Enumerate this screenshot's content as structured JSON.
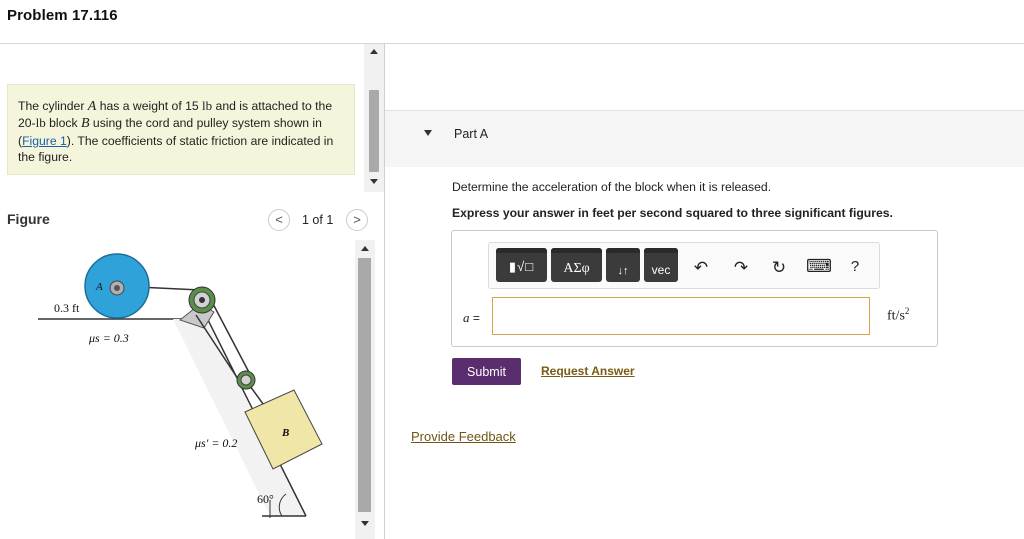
{
  "header": {
    "title": "Problem 17.116"
  },
  "problem": {
    "t1": "The cylinder ",
    "var_a": "A",
    "t2": " has a weight of 15 ",
    "unit_lb1": "lb",
    "t3": " and is attached to the 20-",
    "unit_lb2": "lb",
    "t4": " block ",
    "var_b": "B",
    "t5": " using the cord and pulley system shown in (",
    "fig_link": "Figure 1",
    "t6": "). The coefficients of static friction are indicated in the figure."
  },
  "figure": {
    "label": "Figure",
    "pager": "1 of 1",
    "prev": "<",
    "next": ">",
    "labels": {
      "cyl": "A",
      "radius": "0.3 ft",
      "mu1": "μs = 0.3",
      "mu2": "μs′ = 0.2",
      "block": "B",
      "angle": "60°"
    }
  },
  "part": {
    "title": "Part A",
    "question": "Determine the acceleration of the block when it is released.",
    "instruction": "Express your answer in feet per second squared to three significant figures.",
    "toolbar": {
      "templates": "▮√□",
      "greek": "ΑΣφ",
      "arrows": "↓↑",
      "vec": "vec",
      "undo": "↶",
      "redo": "↷",
      "reset": "↻",
      "keyboard": "⌨",
      "help": "?"
    },
    "var_name": "a",
    "equals": " =",
    "answer_value": "",
    "units": "ft/s",
    "units_exp": "2",
    "submit": "Submit",
    "request": "Request Answer"
  },
  "feedback": "Provide Feedback",
  "colors": {
    "problem_bg": "#f5f5dc",
    "submit_bg": "#5a2d6e",
    "cylinder": "#2fa3d9",
    "block": "#f0e6a8",
    "input_border": "#d9a54a"
  }
}
